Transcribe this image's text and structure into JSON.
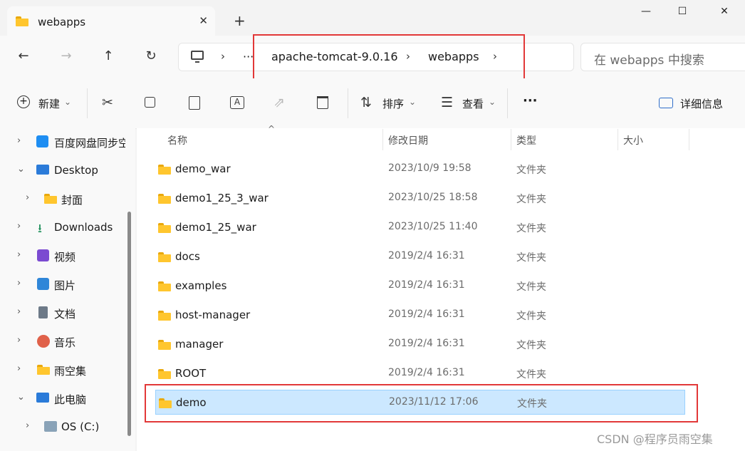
{
  "tab": {
    "title": "webapps",
    "close": "✕",
    "new_tab": "+"
  },
  "window": {
    "minimize": "—",
    "maximize": "☐",
    "close": "✕"
  },
  "nav": {
    "back": "←",
    "forward": "→",
    "up": "↑",
    "refresh": "↻"
  },
  "address": {
    "more": "···",
    "chevron": "›",
    "crumbs": [
      "apache-tomcat-9.0.16",
      "webapps"
    ]
  },
  "search": {
    "placeholder": "在 webapps 中搜索"
  },
  "toolbar": {
    "new_label": "新建",
    "sort_label": "排序",
    "view_label": "查看",
    "more": "···",
    "details_label": "详细信息",
    "caret": "⌄"
  },
  "sidebar": {
    "items": [
      {
        "label": "百度网盘同步空间",
        "arrow": "›"
      },
      {
        "label": "Desktop",
        "arrow": "⌄"
      },
      {
        "label": "封面",
        "arrow": "›"
      },
      {
        "label": "Downloads",
        "arrow": "›"
      },
      {
        "label": "视频",
        "arrow": "›"
      },
      {
        "label": "图片",
        "arrow": "›"
      },
      {
        "label": "文档",
        "arrow": "›"
      },
      {
        "label": "音乐",
        "arrow": "›"
      },
      {
        "label": "雨空集",
        "arrow": "›"
      },
      {
        "label": "此电脑",
        "arrow": "⌄"
      },
      {
        "label": "OS (C:)",
        "arrow": "›"
      }
    ]
  },
  "columns": {
    "name": "名称",
    "date": "修改日期",
    "type": "类型",
    "size": "大小",
    "sort_indicator": "^"
  },
  "files": [
    {
      "name": "demo_war",
      "date": "2023/10/9 19:58",
      "type": "文件夹"
    },
    {
      "name": "demo1_25_3_war",
      "date": "2023/10/25 18:58",
      "type": "文件夹"
    },
    {
      "name": "demo1_25_war",
      "date": "2023/10/25 11:40",
      "type": "文件夹"
    },
    {
      "name": "docs",
      "date": "2019/2/4 16:31",
      "type": "文件夹"
    },
    {
      "name": "examples",
      "date": "2019/2/4 16:31",
      "type": "文件夹"
    },
    {
      "name": "host-manager",
      "date": "2019/2/4 16:31",
      "type": "文件夹"
    },
    {
      "name": "manager",
      "date": "2019/2/4 16:31",
      "type": "文件夹"
    },
    {
      "name": "ROOT",
      "date": "2019/2/4 16:31",
      "type": "文件夹"
    },
    {
      "name": "demo",
      "date": "2023/11/12 17:06",
      "type": "文件夹"
    }
  ],
  "watermark": "CSDN @程序员雨空集",
  "colors": {
    "selection": "#cce8ff",
    "highlight_box": "#e23838",
    "folder": "#ffc62e"
  }
}
